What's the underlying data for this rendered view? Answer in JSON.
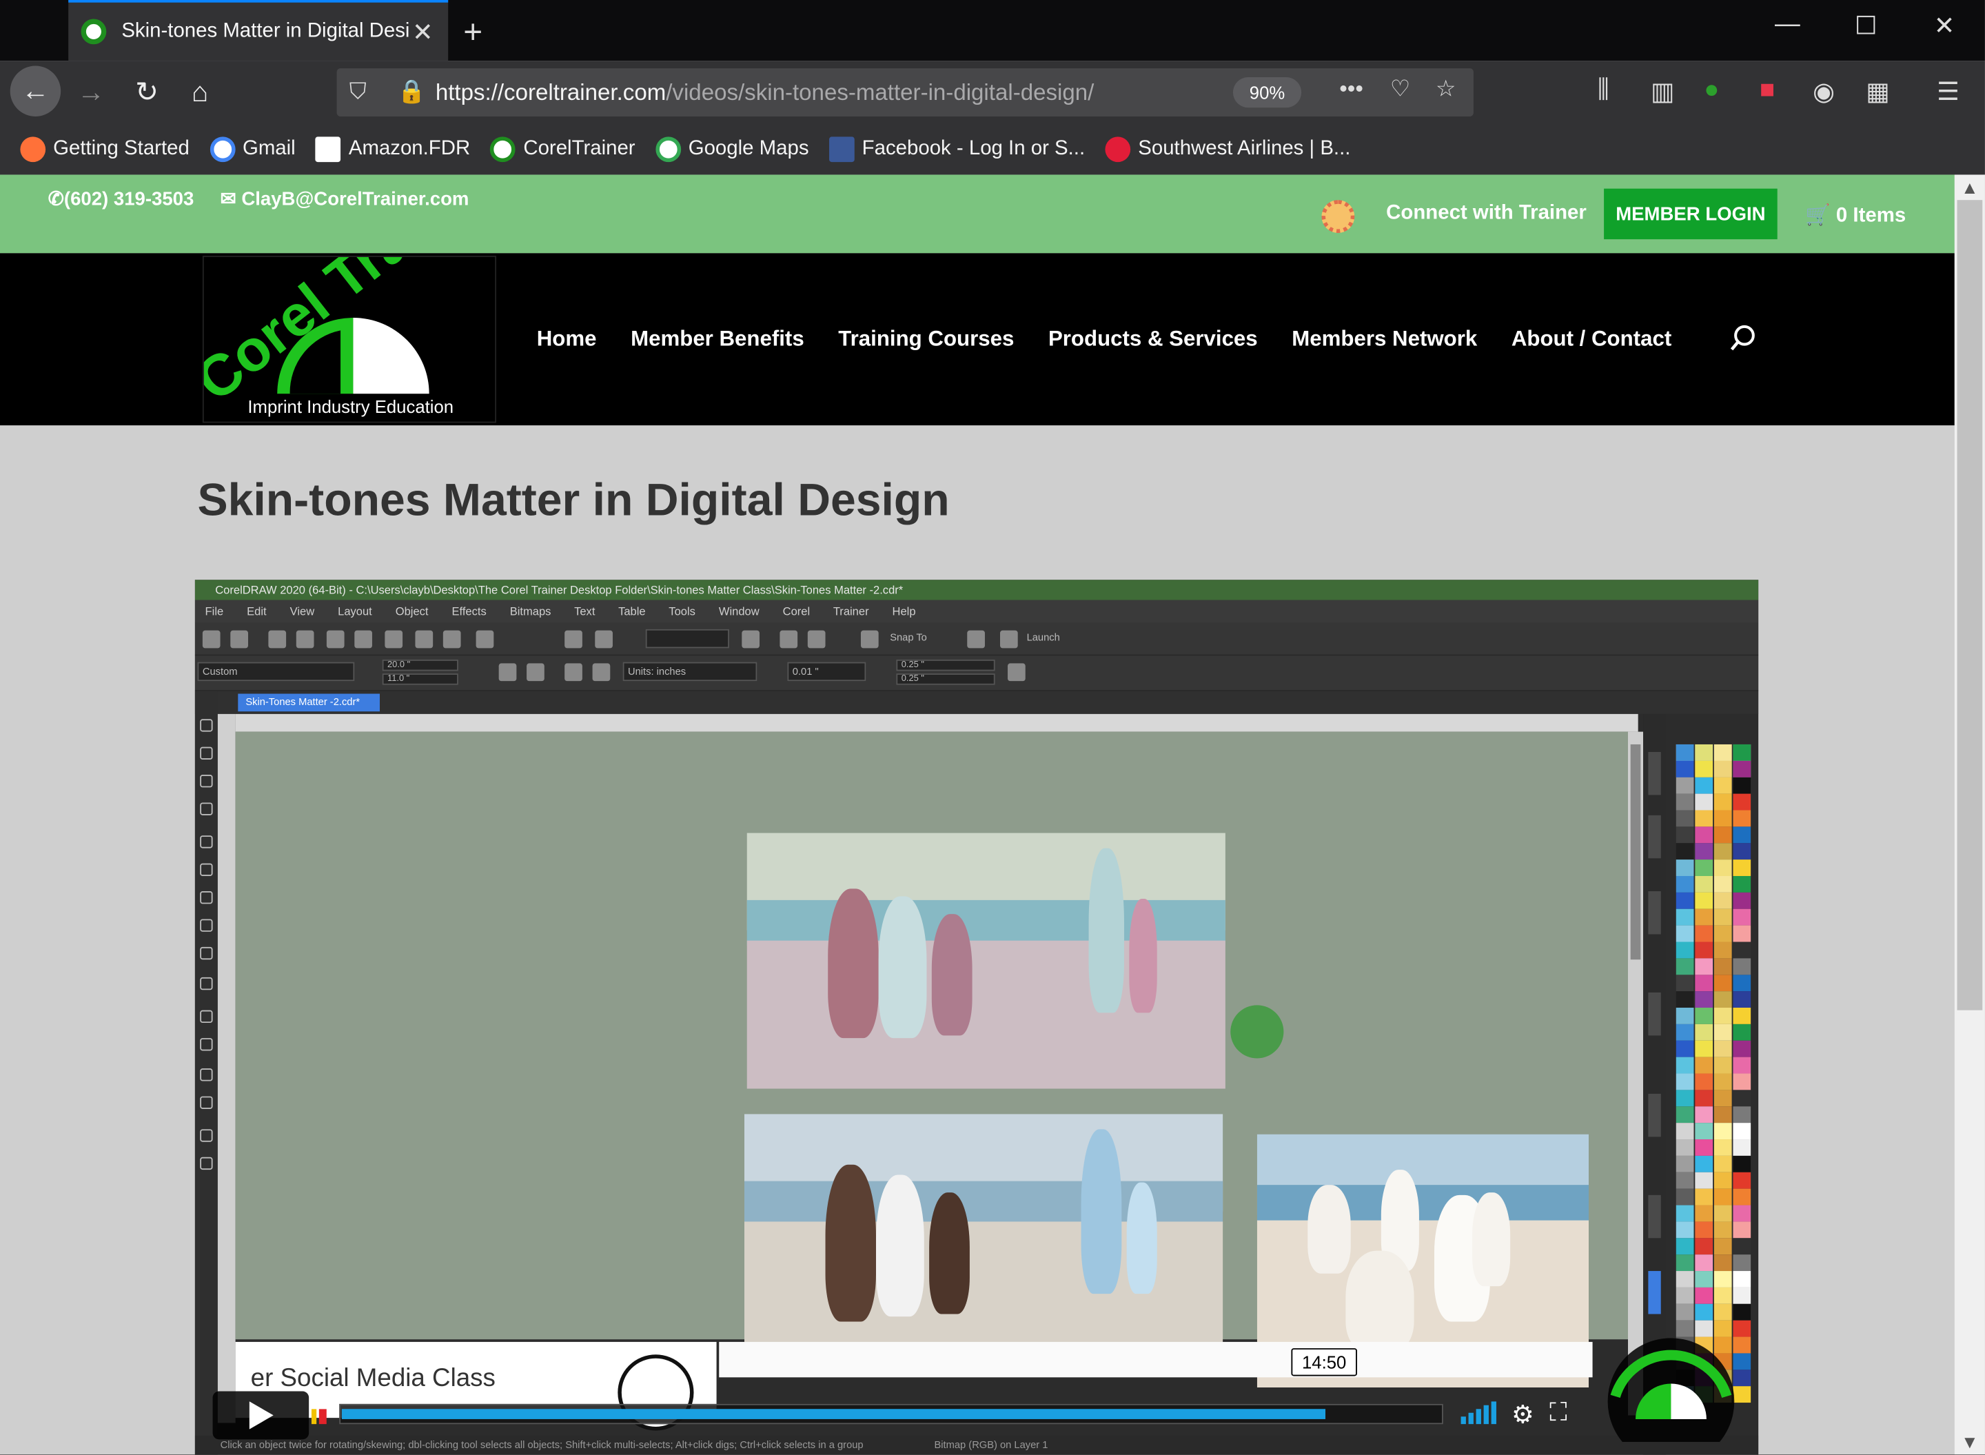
{
  "browser": {
    "tab_title": "Skin-tones Matter in Digital Design - Corel Trainer",
    "url_host": "https://coreltrainer.com",
    "url_path": "/videos/skin-tones-matter-in-digital-design/",
    "zoom": "90%",
    "bookmarks": [
      {
        "label": "Getting Started",
        "color": "#ff7139"
      },
      {
        "label": "Gmail",
        "color": "#ffffff"
      },
      {
        "label": "Amazon.FDR",
        "color": "#ffffff"
      },
      {
        "label": "CorelTrainer",
        "color": "#1f8e1f"
      },
      {
        "label": "Google Maps",
        "color": "#ffffff"
      },
      {
        "label": "Facebook - Log In or S...",
        "color": "#3b5998"
      },
      {
        "label": "Southwest Airlines | B...",
        "color": "#e21d38"
      }
    ]
  },
  "site": {
    "phone": "(602) 319-3503",
    "email": "ClayB@CorelTrainer.com",
    "connect": "Connect with Trainer",
    "member_login": "MEMBER LOGIN",
    "cart": "0 Items",
    "logo_text": "Corel Trainer",
    "logo_tagline": "Imprint Industry Education",
    "nav": [
      "Home",
      "Member Benefits",
      "Training Courses",
      "Products & Services",
      "Members Network",
      "About / Contact"
    ],
    "page_title": "Skin-tones Matter in Digital Design"
  },
  "video": {
    "app_title": "CorelDRAW 2020 (64-Bit) - C:\\Users\\clayb\\Desktop\\The Corel Trainer Desktop Folder\\Skin-tones Matter Class\\Skin-Tones Matter -2.cdr*",
    "menu": "File Edit View Layout Object Effects Bitmaps Text Table Tools Window Corel Trainer Help",
    "doc_tab": "Skin-Tones Matter -2.cdr*",
    "preset": "Custom",
    "width": "20.0 \"",
    "height": "11.0 \"",
    "units": "Units: inches",
    "nudge": "0.01 \"",
    "dup_x": "0.25 \"",
    "dup_y": "0.25 \"",
    "snap": "Snap To",
    "launch": "Launch",
    "overlay_text": "er Social Media Class",
    "status_text": "Click an object twice for rotating/skewing; dbl-clicking tool selects all objects; Shift+click multi-selects; Alt+click digs; Ctrl+click selects in a group",
    "status_right": "Bitmap (RGB) on Layer 1",
    "time_tooltip": "14:50",
    "progress": 0.895
  },
  "colors": {
    "accent": "#7bc47f",
    "login_btn": "#10a12a",
    "progress": "#1aa0e2"
  }
}
